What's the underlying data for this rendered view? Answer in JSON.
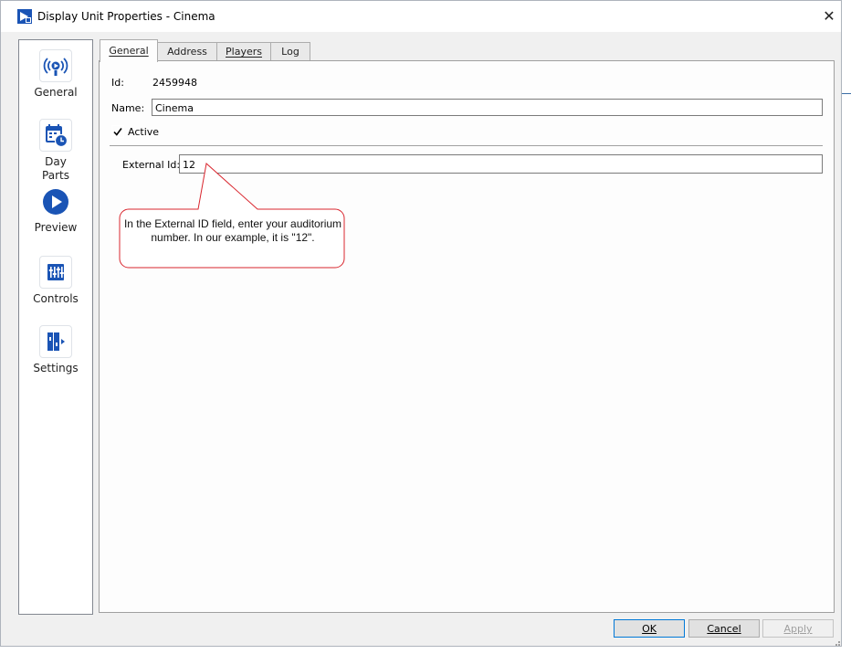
{
  "window": {
    "title": "Display Unit Properties - Cinema",
    "close_glyph": "✕"
  },
  "sidebar": {
    "items": [
      {
        "label": "General",
        "icon": "broadcast-icon"
      },
      {
        "label": "Day\nParts",
        "icon": "calendar-clock-icon"
      },
      {
        "label": "Preview",
        "icon": "play-icon"
      },
      {
        "label": "Controls",
        "icon": "sliders-icon"
      },
      {
        "label": "Settings",
        "icon": "settings-panel-icon"
      }
    ]
  },
  "tabs": [
    {
      "label": "General",
      "active": true
    },
    {
      "label": "Address",
      "active": false
    },
    {
      "label": "Players",
      "active": false
    },
    {
      "label": "Log",
      "active": false
    }
  ],
  "general": {
    "id_label": "Id:",
    "id_value": "2459948",
    "name_label": "Name:",
    "name_value": "Cinema",
    "active_label": "Active",
    "active_checked": true,
    "external_id_label": "External Id:",
    "external_id_value": "12"
  },
  "callout": {
    "text": "In the External ID field, enter your auditorium number. In our example, it is \"12\".",
    "border_color": "#d9262e"
  },
  "buttons": {
    "ok": "OK",
    "cancel": "Cancel",
    "apply": "Apply"
  },
  "colors": {
    "accent": "#1a54b5",
    "focus": "#0078d7"
  }
}
